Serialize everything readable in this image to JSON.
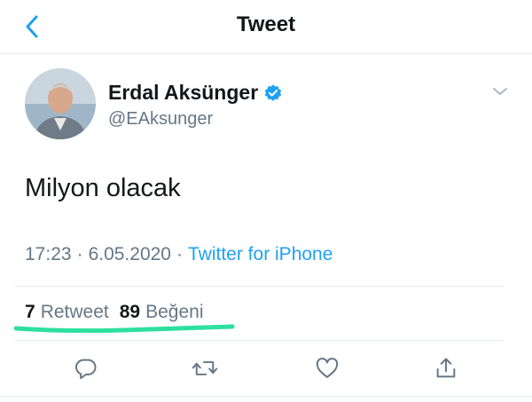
{
  "colors": {
    "accent": "#1da1f2",
    "secondary_text": "#657786",
    "primary_text": "#14171a",
    "highlight_marker": "#2de0a0"
  },
  "header": {
    "title": "Tweet",
    "back_icon": "chevron-left-icon"
  },
  "tweet": {
    "author_name": "Erdal Aksünger",
    "handle": "@EAksunger",
    "verified_icon": "verified-badge-icon",
    "text": "Milyon olacak",
    "time": "17:23",
    "date": "6.05.2020",
    "separator": "·",
    "source": "Twitter for iPhone",
    "retweet_count": "7",
    "retweet_label": "Retweet",
    "like_count": "89",
    "like_label": "Beğeni"
  },
  "actions": [
    "reply-icon",
    "retweet-icon",
    "like-icon",
    "share-icon"
  ]
}
